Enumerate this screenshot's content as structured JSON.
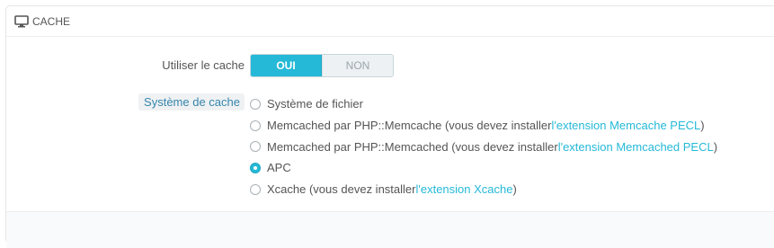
{
  "panel": {
    "title": "CACHE",
    "icon": "monitor-icon"
  },
  "use_cache": {
    "label": "Utiliser le cache",
    "options": [
      "OUI",
      "NON"
    ],
    "selected": "OUI"
  },
  "cache_system": {
    "label": "Système de cache",
    "options": [
      {
        "text": "Système de fichier",
        "link": "",
        "suffix": "",
        "checked": false
      },
      {
        "text": "Memcached par PHP::Memcache (vous devez installer ",
        "link": "l'extension Memcache PECL",
        "suffix": ")",
        "checked": false
      },
      {
        "text": "Memcached par PHP::Memcached (vous devez installer ",
        "link": "l'extension Memcached PECL",
        "suffix": ")",
        "checked": false
      },
      {
        "text": "APC",
        "link": "",
        "suffix": "",
        "checked": true
      },
      {
        "text": "Xcache (vous devez installer ",
        "link": "l'extension Xcache",
        "suffix": ")",
        "checked": false
      }
    ]
  },
  "colors": {
    "accent": "#25b9d7",
    "hint_bg": "#eff1f2",
    "hint_text": "#3586ae"
  }
}
